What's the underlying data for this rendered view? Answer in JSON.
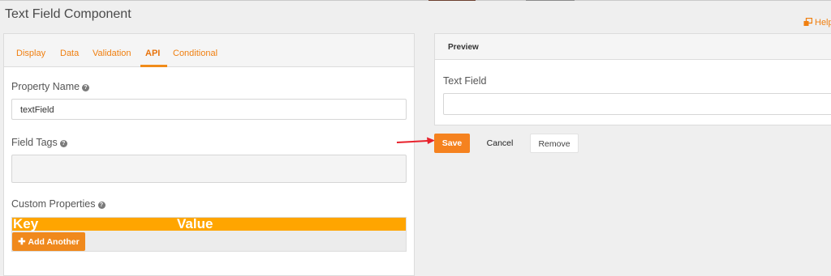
{
  "app": {
    "title": "Text Field Component",
    "help_label": "Help"
  },
  "tabs": [
    {
      "label": "Display",
      "active": false
    },
    {
      "label": "Data",
      "active": false
    },
    {
      "label": "Validation",
      "active": false
    },
    {
      "label": "API",
      "active": true
    },
    {
      "label": "Conditional",
      "active": false
    }
  ],
  "form": {
    "property_name": {
      "label": "Property Name",
      "value": "textField"
    },
    "field_tags": {
      "label": "Field Tags",
      "value": ""
    },
    "custom_properties": {
      "label": "Custom Properties",
      "columns": [
        "Key",
        "Value"
      ],
      "add_label": "Add Another"
    }
  },
  "preview": {
    "title": "Preview",
    "field_label": "Text Field",
    "field_value": ""
  },
  "actions": {
    "save": "Save",
    "cancel": "Cancel",
    "remove": "Remove"
  },
  "colors": {
    "accent": "#f5821f",
    "table_header": "#ffa500",
    "arrow": "#e8212b"
  },
  "icons": {
    "help": "external-window-icon",
    "tooltip": "question-circle-icon",
    "add": "plus-icon",
    "annotation": "red-arrow-icon"
  }
}
